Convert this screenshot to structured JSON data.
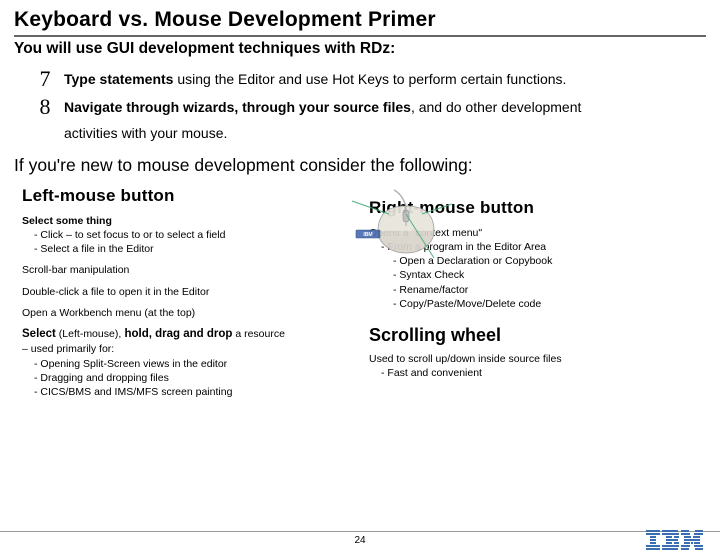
{
  "title": "Keyboard vs. Mouse Development Primer",
  "subtitle": "You will use GUI development techniques with RDz:",
  "bullets": [
    {
      "icon": "7",
      "strong": "Type statements",
      "rest": " using the Editor and use Hot Keys to perform certain functions."
    },
    {
      "icon": "8",
      "strong": "Navigate through wizards, through your source files",
      "rest": ", and do other development",
      "cont": "activities with your mouse."
    }
  ],
  "section_head": "If you're new to mouse development consider the following:",
  "left": {
    "title": "Left-mouse button",
    "select_head": "Select some thing",
    "select_items": [
      "- Click – to set focus to or to select a field",
      "- Select a file in the Editor"
    ],
    "scrollbar": "Scroll-bar manipulation",
    "doubleclick": "Double-click a file to open it in the Editor",
    "workbench": "Open a Workbench menu (at the top)",
    "drag_head_a": "Select",
    "drag_head_b": " (Left-mouse),",
    "drag_head_c": " hold, drag and drop",
    "drag_head_d": " a resource",
    "drag_sub": "– used primarily for:",
    "drag_items": [
      "- Opening Split-Screen views in the editor",
      "- Dragging and dropping files",
      "- CICS/BMS and IMS/MFS screen painting"
    ]
  },
  "right": {
    "title": "Right-mouse button",
    "context1": "Opens a \"context menu\"",
    "context2": "- From a program in the Editor Area",
    "context_items": [
      "- Open a Declaration or Copybook",
      "- Syntax Check",
      "- Rename/factor",
      "- Copy/Paste/Move/Delete code"
    ],
    "scroll_title": "Scrolling wheel",
    "scroll_text": "Used to scroll up/down inside source files",
    "scroll_sub": "- Fast and convenient"
  },
  "page_number": "24",
  "logo_label": "IBM"
}
